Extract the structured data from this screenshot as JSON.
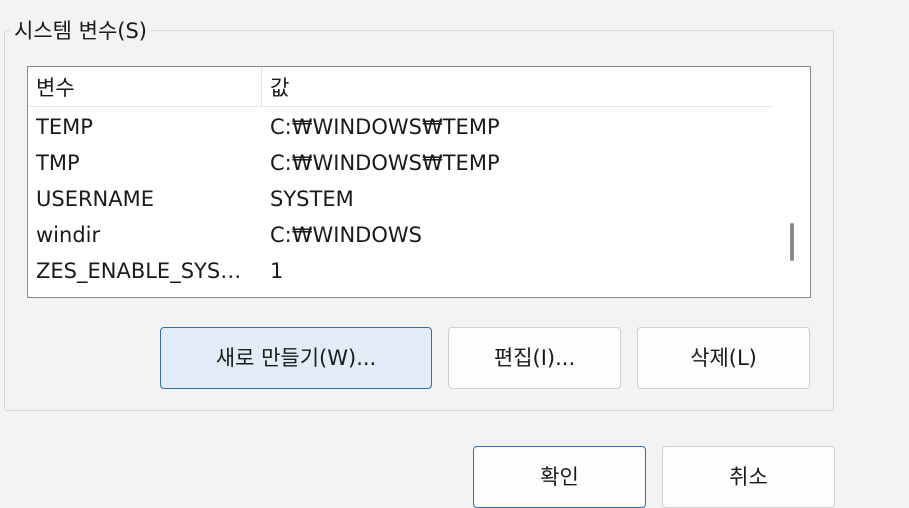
{
  "group": {
    "title": "시스템 변수(S)"
  },
  "list": {
    "columns": {
      "name": "변수",
      "value": "값"
    },
    "rows": [
      {
        "name": "TEMP",
        "value": "C:₩WINDOWS₩TEMP"
      },
      {
        "name": "TMP",
        "value": "C:₩WINDOWS₩TEMP"
      },
      {
        "name": "USERNAME",
        "value": "SYSTEM"
      },
      {
        "name": "windir",
        "value": "C:₩WINDOWS"
      },
      {
        "name": "ZES_ENABLE_SYSM...",
        "value": "1"
      }
    ]
  },
  "buttons": {
    "new_label": "새로 만들기(W)...",
    "edit_label": "편집(I)...",
    "delete_label": "삭제(L)",
    "ok_label": "확인",
    "cancel_label": "취소"
  }
}
